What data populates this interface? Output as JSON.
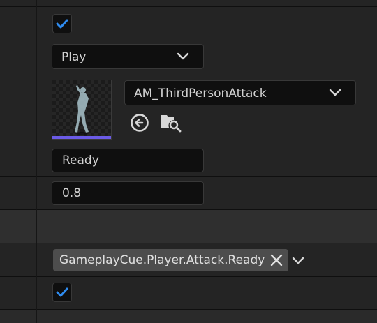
{
  "rows": {
    "checkbox_top": {
      "checked": true
    },
    "play_mode": {
      "value": "Play"
    },
    "montage": {
      "asset_name": "AM_ThirdPersonAttack",
      "browse_icon": "arrow-left-circle-icon",
      "find_icon": "folder-search-icon"
    },
    "state_field": {
      "value": "Ready"
    },
    "number_field": {
      "value": "0.8"
    },
    "gameplay_tag": {
      "value": "GameplayCue.Player.Attack.Ready"
    },
    "checkbox_bottom": {
      "checked": true
    }
  },
  "colors": {
    "check": "#2f8cf0",
    "accent_bar": "#6b5be6"
  }
}
